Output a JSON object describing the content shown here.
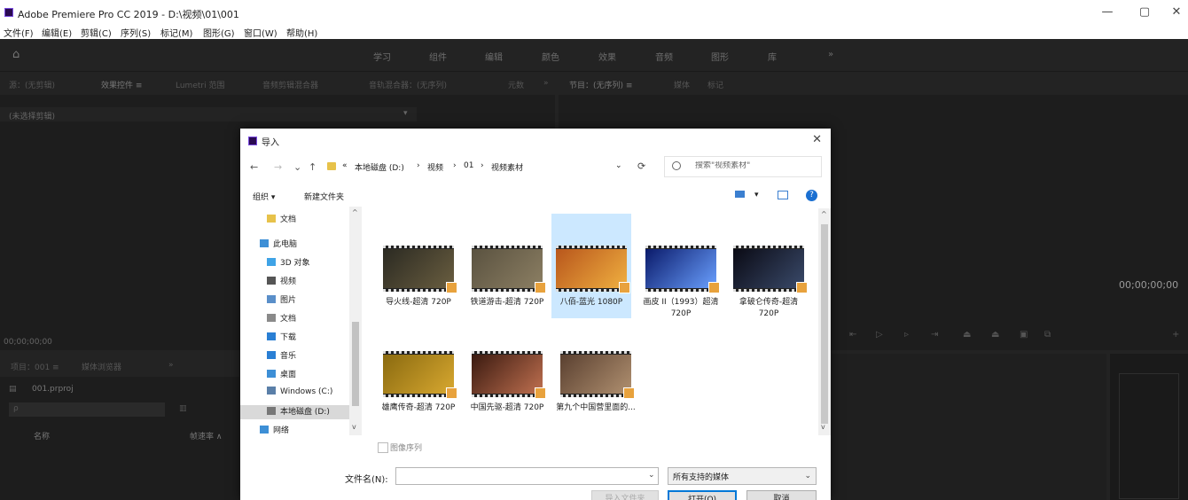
{
  "window": {
    "title": "Adobe Premiere Pro CC 2019 - D:\\视频\\01\\001",
    "minimize": "—",
    "maximize": "▢",
    "close": "✕"
  },
  "menu": [
    "文件(F)",
    "编辑(E)",
    "剪辑(C)",
    "序列(S)",
    "标记(M)",
    "图形(G)",
    "窗口(W)",
    "帮助(H)"
  ],
  "workspaces": [
    "学习",
    "组件",
    "编辑",
    "颜色",
    "效果",
    "音频",
    "图形",
    "库",
    "»"
  ],
  "source_panel": {
    "tabs": [
      "源：(无剪辑)",
      "效果控件 ≡",
      "Lumetri 范围",
      "音频剪辑混合器",
      "音轨混合器：(无序列)",
      "元数",
      "»"
    ],
    "placeholder": "(未选择剪辑)",
    "timecode": "00;00;00;00"
  },
  "program_panel": {
    "tabs": [
      "节目：(无序列) ≡",
      "媒体",
      "标记"
    ],
    "timecode": "00;00;00;00"
  },
  "project_panel": {
    "tabs": [
      "项目：001 ≡",
      "媒体浏览器",
      "»"
    ],
    "file": "001.prproj",
    "search_placeholder": "ρ",
    "column_name": "名称",
    "column_rate": "帧速率 ∧"
  },
  "dialog": {
    "title": "导入",
    "close": "✕",
    "nav": [
      "←",
      "→",
      "⌄",
      "↑"
    ],
    "breadcrumb": [
      "«",
      "本地磁盘 (D:)",
      "›",
      "视频",
      "›",
      "01",
      "›",
      "视频素材"
    ],
    "address_dropdown": "⌄",
    "refresh": "⟳",
    "search_placeholder": "搜索\"视频素材\"",
    "organize": "组织 ▾",
    "new_folder": "新建文件夹",
    "view_dropdown": "▾",
    "help": "?",
    "nav_items": [
      {
        "label": "文档",
        "icon": "folder-icon",
        "color": "#e7c24a"
      },
      {
        "label": "此电脑",
        "icon": "computer-icon",
        "color": "#3d8fd6"
      },
      {
        "label": "3D 对象",
        "icon": "cube-icon",
        "color": "#3fa3e6"
      },
      {
        "label": "视频",
        "icon": "video-icon",
        "color": "#555555"
      },
      {
        "label": "图片",
        "icon": "picture-icon",
        "color": "#5a8fc9"
      },
      {
        "label": "文档",
        "icon": "document-icon",
        "color": "#8a8a8a"
      },
      {
        "label": "下载",
        "icon": "download-icon",
        "color": "#2a7fd4"
      },
      {
        "label": "音乐",
        "icon": "music-icon",
        "color": "#2a7fd4"
      },
      {
        "label": "桌面",
        "icon": "desktop-icon",
        "color": "#3d8fd6"
      },
      {
        "label": "Windows (C:)",
        "icon": "drive-icon",
        "color": "#5a7fa8"
      },
      {
        "label": "本地磁盘 (D:)",
        "icon": "drive-icon",
        "color": "#777777"
      },
      {
        "label": "网络",
        "icon": "network-icon",
        "color": "#3d8fd6"
      }
    ],
    "files": [
      {
        "name": "导火线-超清 720P",
        "colors": [
          "#2b2a22",
          "#6a5e40"
        ]
      },
      {
        "name": "铁道游击-超清 720P",
        "colors": [
          "#5a5240",
          "#8c7f63"
        ]
      },
      {
        "name": "八佰-蓝光 1080P",
        "colors": [
          "#b8561c",
          "#f0b040"
        ]
      },
      {
        "name": "画皮 II（1993）超清720P",
        "colors": [
          "#0a1a6a",
          "#6aa0ff"
        ]
      },
      {
        "name": "拿破仑传奇-超清 720P",
        "colors": [
          "#0a0a14",
          "#3a4a6a"
        ]
      },
      {
        "name": "雄鹰传奇-超清 720P",
        "colors": [
          "#8a6a10",
          "#d8a830"
        ]
      },
      {
        "name": "中国先驱-超清 720P",
        "colors": [
          "#3a1a10",
          "#c07050"
        ]
      },
      {
        "name": "第九个中国营里面的...",
        "colors": [
          "#5a4030",
          "#b09070"
        ]
      }
    ],
    "image_sequence": "图像序列",
    "filename_label": "文件名(N):",
    "filename_value": "",
    "filename_dropdown": "⌄",
    "file_type": "所有支持的媒体",
    "file_type_arrow": "⌄",
    "buttons": {
      "import_folder": "导入文件夹",
      "open": "打开(O)",
      "cancel": "取消"
    }
  }
}
